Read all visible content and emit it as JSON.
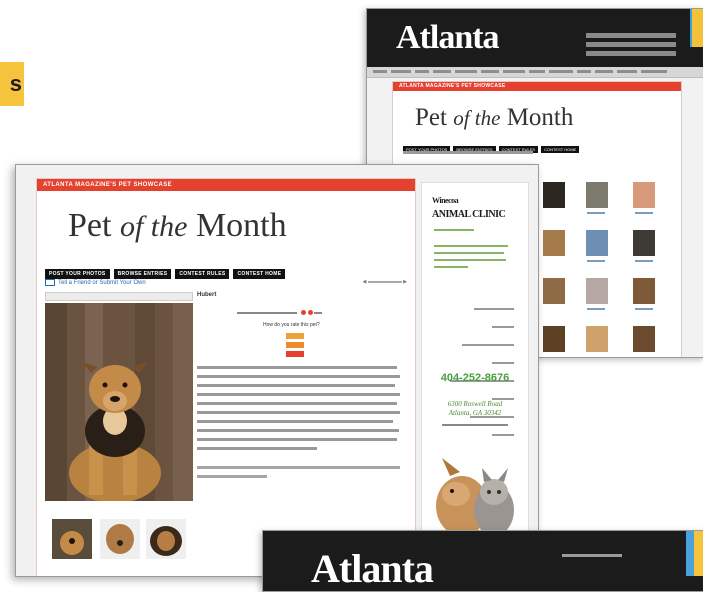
{
  "yellow_tag": {
    "text": "s"
  },
  "back_window": {
    "logo": "Atlanta",
    "banner": "ATLANTA MAGAZINE'S PET SHOWCASE",
    "title_pre": "Pet",
    "title_mid": "of the",
    "title_post": "Month",
    "buttons": [
      "POST YOUR PHOTOS",
      "BROWSE ENTRIES",
      "CONTEST RULES",
      "CONTEST HOME"
    ]
  },
  "front_window": {
    "banner": "ATLANTA MAGAZINE'S PET SHOWCASE",
    "title_pre": "Pet",
    "title_mid": "of the",
    "title_post": "Month",
    "buttons": [
      "POST YOUR PHOTOS",
      "BROWSE ENTRIES",
      "CONTEST RULES",
      "CONTEST HOME"
    ],
    "tell_friend": "Tell a Friend or Submit Your Own",
    "dog_name": "Hubert",
    "vote_question": "How do you rate this pet?",
    "ad": {
      "logo_line1": "Winecoa",
      "logo_line2": "ANIMAL CLINIC",
      "phone": "404-252-8676",
      "address_line1": "6300 Roswell Road",
      "address_line2": "Atlanta, GA 30342"
    }
  },
  "bottom_window": {
    "logo": "Atlanta"
  },
  "colors": {
    "accent_red": "#e5412f",
    "header_black": "#1b1b1b",
    "tag_yellow": "#f6c33d",
    "ad_green": "#47a13d"
  }
}
